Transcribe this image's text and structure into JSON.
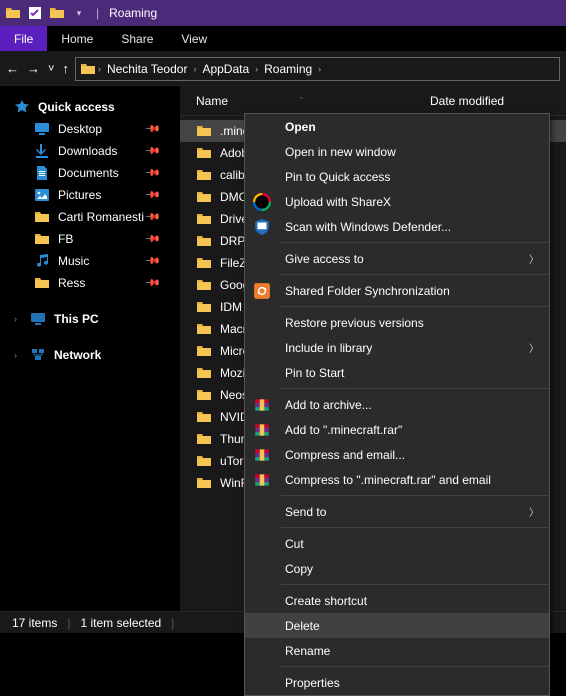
{
  "window": {
    "title": "Roaming"
  },
  "ribbon": {
    "file": "File",
    "tabs": [
      "Home",
      "Share",
      "View"
    ]
  },
  "breadcrumbs": [
    "Nechita Teodor",
    "AppData",
    "Roaming"
  ],
  "sidebar": {
    "quick_access": "Quick access",
    "quick_items": [
      {
        "label": "Desktop",
        "icon": "desktop-icon",
        "pinned": true
      },
      {
        "label": "Downloads",
        "icon": "downloads-icon",
        "pinned": true
      },
      {
        "label": "Documents",
        "icon": "documents-icon",
        "pinned": true
      },
      {
        "label": "Pictures",
        "icon": "pictures-icon",
        "pinned": true
      },
      {
        "label": "Carti Romanesti",
        "icon": "folder-icon",
        "pinned": true
      },
      {
        "label": "FB",
        "icon": "folder-icon",
        "pinned": true
      },
      {
        "label": "Music",
        "icon": "music-icon",
        "pinned": true
      },
      {
        "label": "Ress",
        "icon": "folder-icon",
        "pinned": true
      }
    ],
    "this_pc": "This PC",
    "network": "Network"
  },
  "columns": {
    "name": "Name",
    "date": "Date modified"
  },
  "files": [
    ".minecraft",
    "Adobe",
    "calibre",
    "DMCache",
    "DriverPack",
    "DRPSu",
    "FileZilla",
    "GoogleChrome",
    "IDM",
    "Macromedia",
    "Microsoft",
    "Mozilla",
    "Neos Eu",
    "NVIDIA",
    "Thunderbird",
    "uTorrent",
    "WinRAR"
  ],
  "files_display": [
    ".minecr",
    "Adobe",
    "calibre",
    "DMCac",
    "DriverP",
    "DRPSu",
    "FileZilla",
    "Google",
    "IDM",
    "Macron",
    "Microso",
    "Mozilla",
    "Neos Eu",
    "NVIDIA",
    "Thunde",
    "uTorren",
    "WinRAR"
  ],
  "selected_index": 0,
  "context_menu": {
    "sections": [
      [
        {
          "label": "Open",
          "bold": true
        },
        {
          "label": "Open in new window"
        },
        {
          "label": "Pin to Quick access"
        },
        {
          "label": "Upload with ShareX",
          "icon": "sharex-icon"
        },
        {
          "label": "Scan with Windows Defender...",
          "icon": "defender-icon"
        }
      ],
      [
        {
          "label": "Give access to",
          "submenu": true
        }
      ],
      [
        {
          "label": "Shared Folder Synchronization",
          "icon": "sync-icon"
        }
      ],
      [
        {
          "label": "Restore previous versions"
        },
        {
          "label": "Include in library",
          "submenu": true
        },
        {
          "label": "Pin to Start"
        }
      ],
      [
        {
          "label": "Add to archive...",
          "icon": "winrar-icon"
        },
        {
          "label": "Add to \".minecraft.rar\"",
          "icon": "winrar-icon"
        },
        {
          "label": "Compress and email...",
          "icon": "winrar-icon"
        },
        {
          "label": "Compress to \".minecraft.rar\" and email",
          "icon": "winrar-icon"
        }
      ],
      [
        {
          "label": "Send to",
          "submenu": true
        }
      ],
      [
        {
          "label": "Cut"
        },
        {
          "label": "Copy"
        }
      ],
      [
        {
          "label": "Create shortcut"
        },
        {
          "label": "Delete",
          "hover": true
        },
        {
          "label": "Rename"
        }
      ],
      [
        {
          "label": "Properties"
        }
      ]
    ]
  },
  "status": {
    "count": "17 items",
    "selected": "1 item selected"
  }
}
